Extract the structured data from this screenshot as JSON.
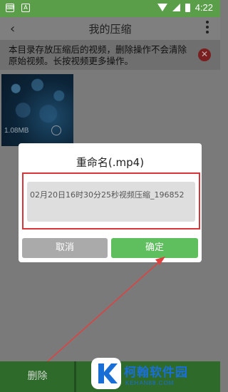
{
  "status_bar": {
    "time": "4:22",
    "icons": [
      "keyboard-icon",
      "a-icon",
      "wifi-icon",
      "signal-icon",
      "battery-icon"
    ]
  },
  "header": {
    "title": "我的压缩"
  },
  "notice": {
    "text": "本目录存放压缩后的视频，删除操作不会清除原始视频。长按视频更多操作。"
  },
  "video": {
    "size": "1.08MB"
  },
  "dialog": {
    "title": "重命名(.mp4)",
    "input_value": "02月20日16时30分25秒视频压缩_196852",
    "cancel_label": "取消",
    "ok_label": "确定"
  },
  "bottom_bar": {
    "delete_label": "删除"
  },
  "watermark": {
    "name": "柯翰软件园",
    "url": "KEHAN88.COM"
  },
  "colors": {
    "status_green": "#5a9e4a",
    "ok_green": "#5fbf5f",
    "highlight_red": "#d9343a",
    "watermark_blue": "#1a6fd6"
  }
}
